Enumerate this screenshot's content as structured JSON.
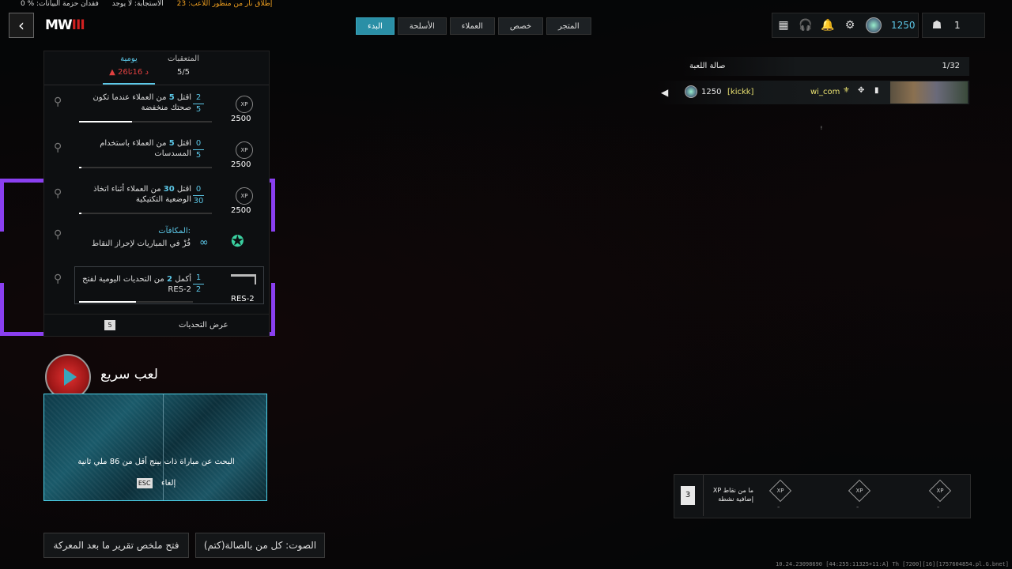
{
  "status": {
    "fire_perspective": "إطلاق نار من منظور اللاعب: 23",
    "response": "الاستجابة: لا يوجد",
    "packet_loss": "فقدان حزمة البيانات: % 0"
  },
  "logo": {
    "text": "MW",
    "accent": "III"
  },
  "nav": {
    "tabs": [
      {
        "label": "البدء",
        "active": true
      },
      {
        "label": "الأسلحة"
      },
      {
        "label": "العملاء"
      },
      {
        "label": "خصص"
      },
      {
        "label": "المتجر"
      }
    ]
  },
  "top_right": {
    "cp": "1250",
    "party_count": "1"
  },
  "challenges": {
    "tab_daily": "يومية",
    "timer": "26د 16ثا",
    "tab_trackers": "المتعقبات",
    "trackers_count": "5/5",
    "rows": [
      {
        "text_a": "اقتل ",
        "num": "5",
        "text_b": " من العملاء عندما تكون صحتك منخفضة",
        "cur": "2",
        "max": "5",
        "xp": "2500",
        "progress": 0.4
      },
      {
        "text_a": "اقتل ",
        "num": "5",
        "text_b": " من العملاء باستخدام المسدسات",
        "cur": "0",
        "max": "5",
        "xp": "2500",
        "progress": 0.02
      },
      {
        "text_a": "اقتل ",
        "num": "30",
        "text_b": " من العملاء أثناء اتخاذ الوضعية التكتيكية",
        "cur": "0",
        "max": "30",
        "xp": "2500",
        "progress": 0.02
      }
    ],
    "rewards_label": "المكافآت:",
    "rewards_text": "فُزْ في المباريات لإحراز النقاط",
    "rewards_value": "∞",
    "unlock": {
      "text_a": "أكمل ",
      "num": "2",
      "text_b": " من التحديات اليومية لفتح RES-2",
      "cur": "1",
      "max": "2",
      "weapon": "RES-2",
      "progress": 0.5
    },
    "view_label": "عرض التحديات",
    "view_key": "5"
  },
  "quickplay": {
    "title": "لعب سريع",
    "search": "البحث عن مباراة ذات بينج أقل من 86 ملي ثانية",
    "cancel": "إلغاء",
    "cancel_key": "ESC"
  },
  "bottom": {
    "voice": "الصوت: كل من بالصالة(كتم)",
    "report": "فتح ملخص تقرير ما بعد المعركة"
  },
  "lobby": {
    "title": "صالة اللعبة",
    "count": "1/32",
    "player": {
      "cp": "1250",
      "clan": "[kickk]",
      "name": "wi_com"
    }
  },
  "xp_box": {
    "count": "3",
    "text": "ما من نقاط XP إضافية نشطة",
    "badges": [
      "XP",
      "XP",
      "XP"
    ],
    "dashes": [
      "-",
      "-",
      "-"
    ]
  },
  "footer": "10.24.23098690 [44:255:11325+11:A] Th [7200][16][1757604854.pl.G.bnet]"
}
